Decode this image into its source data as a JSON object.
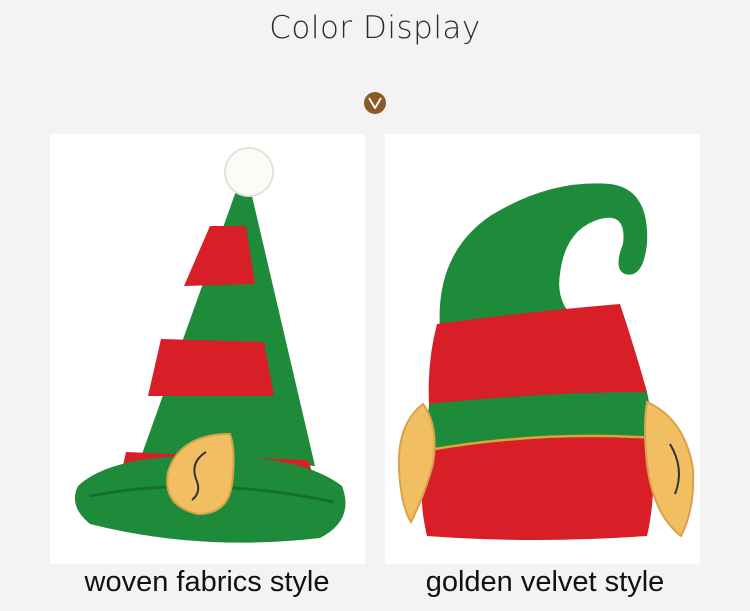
{
  "header": {
    "title": "Color Display",
    "badge_icon": "chevron-down-icon"
  },
  "products": [
    {
      "caption": "woven fabrics style",
      "image": "striped elf hat with pompom and ear"
    },
    {
      "caption": "golden velvet style",
      "image": "curled elf hat with gold trim and ears"
    }
  ],
  "colors": {
    "background": "#f3f3f3",
    "badge": "#8a5a2b",
    "green": "#1e8b3a",
    "red": "#d81e27",
    "ear": "#f1be62",
    "gold": "#d8a63a"
  }
}
